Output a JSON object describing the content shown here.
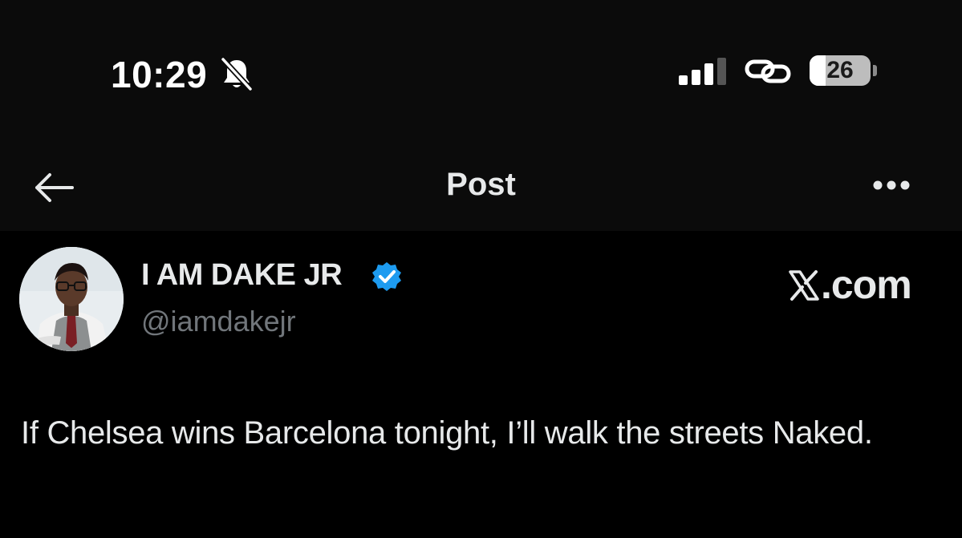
{
  "status_bar": {
    "time": "10:29",
    "battery_level": "26",
    "battery_fraction": 0.26,
    "icons": [
      "bell-slash-icon",
      "cellular-signal-icon",
      "link-icon",
      "battery-icon"
    ]
  },
  "nav": {
    "title": "Post",
    "back_icon": "arrow-left-icon",
    "more_icon": "more-horizontal-icon"
  },
  "post": {
    "author": {
      "display_name": "I AM DAKE JR",
      "handle": "@iamdakejr",
      "verified": true,
      "avatar_icon": "avatar-photo"
    },
    "source_label": ".com",
    "text": "If Chelsea wins Barcelona tonight, I’ll walk the streets Naked."
  },
  "colors": {
    "background": "#000000",
    "header_background": "#0b0b0b",
    "text_primary": "#e7e9ea",
    "text_secondary": "#71767b",
    "verified_blue": "#1d9bf0"
  }
}
